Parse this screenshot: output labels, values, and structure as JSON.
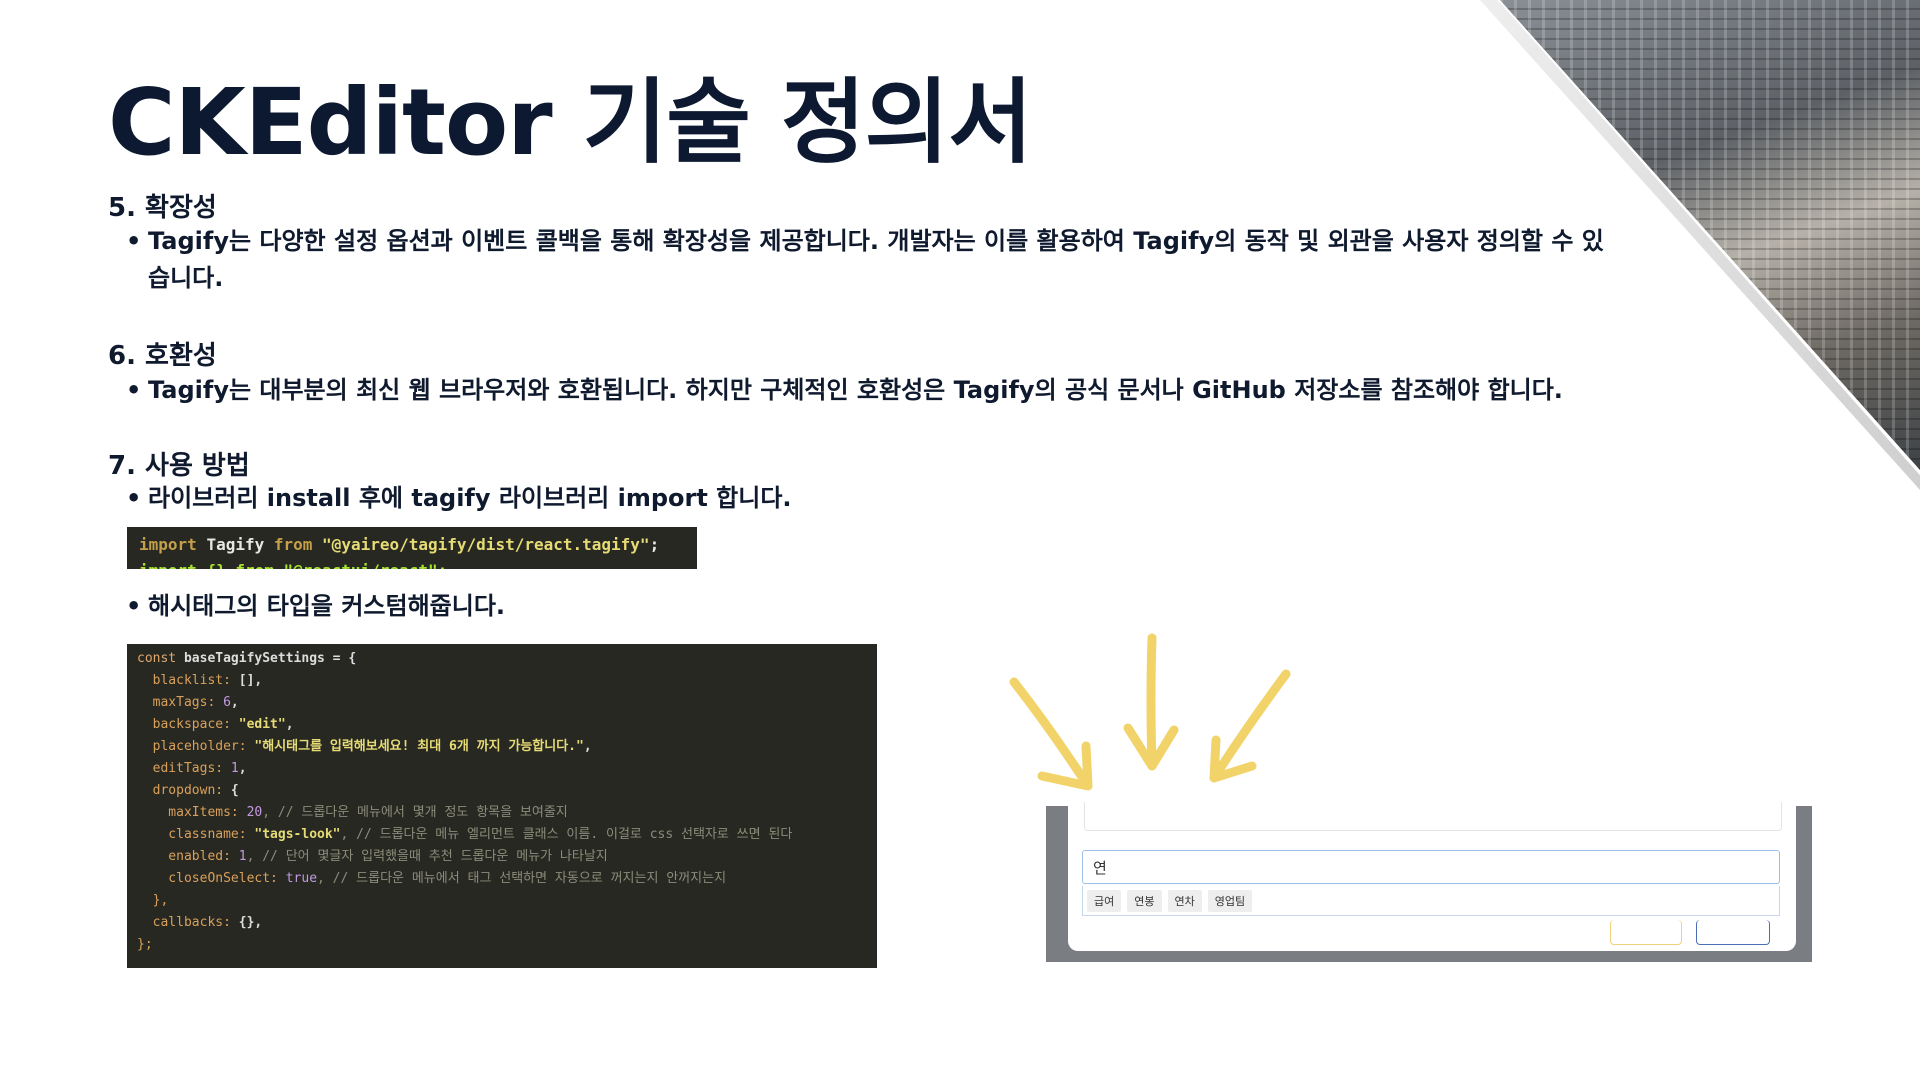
{
  "title": "CKEditor 기술 정의서",
  "sections": [
    {
      "heading": "5. 확장성",
      "bullets": [
        "Tagify는 다양한 설정 옵션과 이벤트 콜백을 통해 확장성을 제공합니다. 개발자는 이를 활용하여 Tagify의 동작 및 외관을 사용자 정의할 수 있",
        "습니다."
      ]
    },
    {
      "heading": "6. 호환성",
      "bullets": [
        "Tagify는 대부분의 최신 웹 브라우저와 호환됩니다. 하지만 구체적인 호환성은 Tagify의 공식 문서나 GitHub 저장소를 참조해야 합니다."
      ]
    },
    {
      "heading": "7. 사용 방법",
      "bullets": [
        "라이브러리 install 후에 tagify 라이브러리 import 합니다.",
        "해시태그의 타입을 커스텀해줍니다."
      ]
    }
  ],
  "bullet_symbol": "•",
  "code_import": {
    "kw_import": "import",
    "ident": "Tagify",
    "kw_from": "from",
    "path": "\"@yaireo/tagify/dist/react.tagify\"",
    "semi": ";",
    "line2_partial": "import {} from \"@reactui/react\";"
  },
  "code_settings": {
    "lines": [
      [
        "const ",
        "baseTagifySettings",
        " = {"
      ],
      [
        "  blacklist: ",
        "[]",
        ","
      ],
      [
        "  maxTags: ",
        "6",
        ","
      ],
      [
        "  backspace: ",
        "\"edit\"",
        ","
      ],
      [
        "  placeholder: ",
        "\"해시태그를 입력해보세요! 최대 6개 까지 가능합니다.\"",
        ","
      ],
      [
        "  editTags: ",
        "1",
        ","
      ],
      [
        "  dropdown: ",
        "{",
        ""
      ],
      [
        "    maxItems: ",
        "20",
        ", // 드롭다운 메뉴에서 몇개 정도 항목을 보여줄지"
      ],
      [
        "    classname: ",
        "\"tags-look\"",
        ", // 드롭다운 메뉴 엘리먼트 클래스 이름. 이걸로 css 선택자로 쓰면 된다"
      ],
      [
        "    enabled: ",
        "1",
        ", // 단어 몇글자 입력했을때 추천 드롭다운 메뉴가 나타날지"
      ],
      [
        "    closeOnSelect: ",
        "true",
        ", // 드롭다운 메뉴에서 태그 선택하면 자동으로 꺼지는지 안꺼지는지"
      ],
      [
        "  },",
        "",
        ""
      ],
      [
        "  callbacks: ",
        "{}",
        ","
      ],
      [
        "};",
        "",
        ""
      ]
    ]
  },
  "screenshot": {
    "input_value": "연",
    "dropdown_items": [
      "급여",
      "연봉",
      "연차",
      "영업팀"
    ]
  },
  "colors": {
    "title": "#0c1930",
    "text": "#0f1a2e",
    "code_bg": "#272822",
    "arrow": "#f2d36a"
  }
}
